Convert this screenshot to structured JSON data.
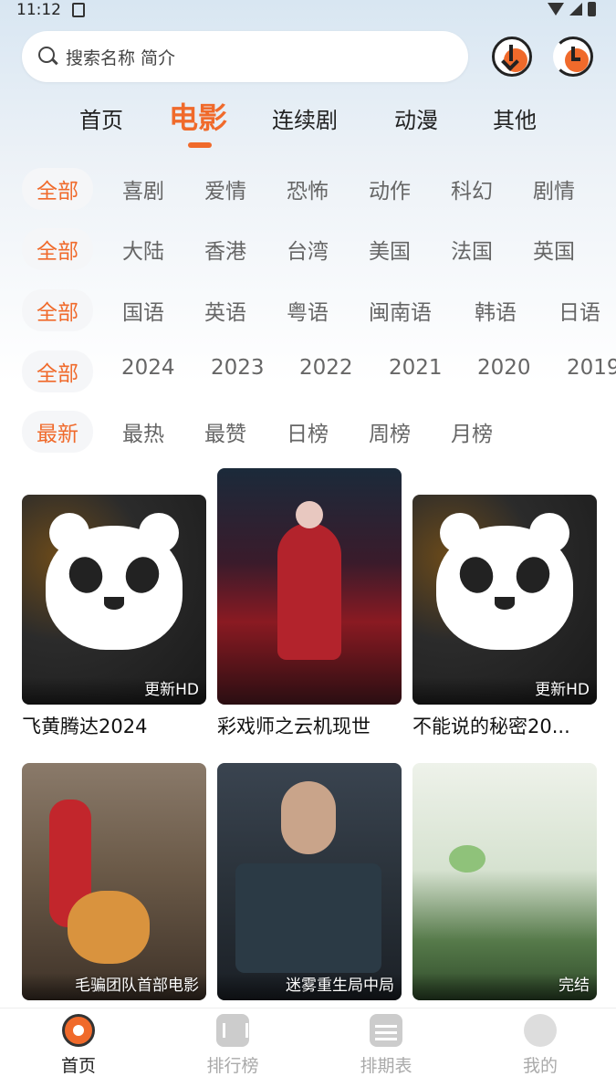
{
  "status_bar": {
    "time": "11:12"
  },
  "search": {
    "placeholder": "搜索名称 简介"
  },
  "top_icons": {
    "download": "download-icon",
    "history": "history-icon",
    "accent": "#f06a2b"
  },
  "main_tabs": [
    {
      "label": "首页",
      "active": false
    },
    {
      "label": "电影",
      "active": true
    },
    {
      "label": "连续剧",
      "active": false
    },
    {
      "label": "动漫",
      "active": false
    },
    {
      "label": "其他",
      "active": false
    }
  ],
  "filters": {
    "genre": [
      "全部",
      "喜剧",
      "爱情",
      "恐怖",
      "动作",
      "科幻",
      "剧情"
    ],
    "region": [
      "全部",
      "大陆",
      "香港",
      "台湾",
      "美国",
      "法国",
      "英国"
    ],
    "language": [
      "全部",
      "国语",
      "英语",
      "粤语",
      "闽南语",
      "韩语",
      "日语"
    ],
    "year": [
      "全部",
      "2024",
      "2023",
      "2022",
      "2021",
      "2020",
      "2019"
    ],
    "sort": [
      "最新",
      "最热",
      "最赞",
      "日榜",
      "周榜",
      "月榜"
    ]
  },
  "movies": [
    {
      "title": "飞黄腾达2024",
      "badge": "更新HD"
    },
    {
      "title": "彩戏师之云机现世",
      "badge": ""
    },
    {
      "title": "不能说的秘密20...",
      "badge": "更新HD"
    },
    {
      "title": "",
      "badge": "毛骗团队首部电影"
    },
    {
      "title": "",
      "badge": "迷雾重生局中局"
    },
    {
      "title": "",
      "badge": "完结"
    }
  ],
  "bottom_nav": [
    {
      "label": "首页",
      "icon": "home-icon",
      "active": true
    },
    {
      "label": "排行榜",
      "icon": "ranking-icon",
      "active": false
    },
    {
      "label": "排期表",
      "icon": "schedule-icon",
      "active": false
    },
    {
      "label": "我的",
      "icon": "profile-icon",
      "active": false
    }
  ]
}
